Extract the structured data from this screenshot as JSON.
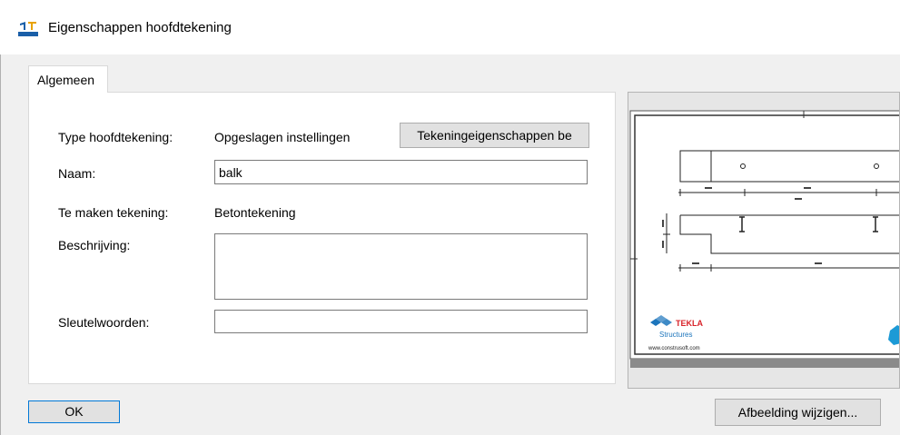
{
  "window": {
    "title": "Eigenschappen hoofdtekening",
    "icon": "drawing-properties-icon"
  },
  "tabs": [
    {
      "label": "Algemeen",
      "active": true
    }
  ],
  "form": {
    "type_label": "Type hoofdtekening:",
    "type_value": "Opgeslagen instellingen",
    "drawing_props_button": "Tekeningeigenschappen be",
    "name_label": "Naam:",
    "name_value": "balk",
    "drawing_to_make_label": "Te maken tekening:",
    "drawing_to_make_value": "Betontekening",
    "description_label": "Beschrijving:",
    "description_value": "",
    "keywords_label": "Sleutelwoorden:",
    "keywords_value": ""
  },
  "preview": {
    "brand_name": "TEKLA",
    "brand_sub": "Structures",
    "website": "www.construsoft.com"
  },
  "buttons": {
    "ok": "OK",
    "change_image": "Afbeelding wijzigen..."
  },
  "colors": {
    "accent": "#0078d7",
    "tekla_red": "#d8232a",
    "tekla_blue": "#1c75bc"
  }
}
